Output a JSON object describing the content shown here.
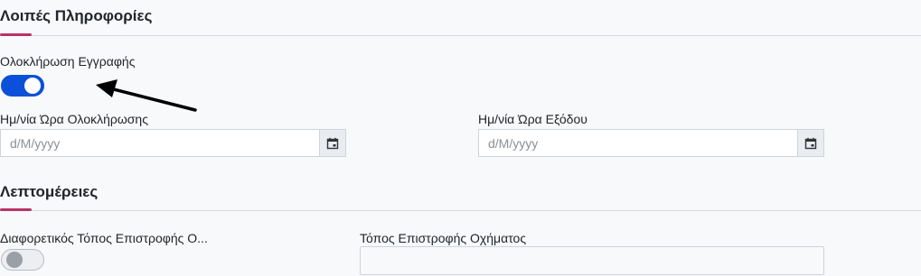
{
  "sections": {
    "other_info": {
      "title": "Λοιπές Πληροφορίες"
    },
    "details": {
      "title": "Λεπτομέρειες"
    }
  },
  "fields": {
    "completion_toggle": {
      "label": "Ολοκλήρωση Εγγραφής",
      "checked": true
    },
    "completion_datetime": {
      "label": "Ημ/νία Ώρα Ολοκλήρωσης",
      "placeholder": "d/M/yyyy",
      "value": ""
    },
    "exit_datetime": {
      "label": "Ημ/νία Ώρα Εξόδου",
      "placeholder": "d/M/yyyy",
      "value": ""
    },
    "different_return_toggle": {
      "label": "Διαφορετικός Τόπος Επιστροφής Ο...",
      "checked": false
    },
    "return_location": {
      "label": "Τόπος Επιστροφής Οχήματος",
      "value": ""
    }
  },
  "icons": {
    "calendar": "calendar-icon",
    "annotation_arrow": "arrow-icon"
  },
  "colors": {
    "accent": "#b83465",
    "toggle_on": "#0b50d8",
    "toggle_off": "#eceef1"
  }
}
